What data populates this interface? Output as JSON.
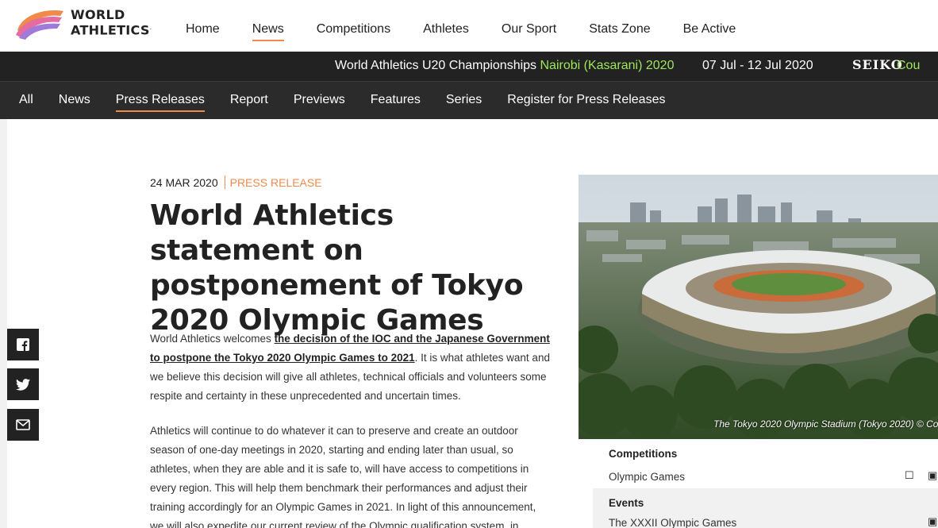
{
  "brand": {
    "line1": "WORLD",
    "line2": "ATHLETICS",
    "mark": "."
  },
  "main_nav": [
    {
      "label": "Home",
      "active": false
    },
    {
      "label": "News",
      "active": true
    },
    {
      "label": "Competitions",
      "active": false
    },
    {
      "label": "Athletes",
      "active": false
    },
    {
      "label": "Our Sport",
      "active": false
    },
    {
      "label": "Stats Zone",
      "active": false
    },
    {
      "label": "Be Active",
      "active": false
    }
  ],
  "ticker": {
    "event": "World Athletics U20 Championships",
    "location": "Nairobi (Kasarani) 2020",
    "dates": "07 Jul - 12 Jul 2020",
    "sponsor": "SEIKO",
    "sponsor_suffix": "Cou"
  },
  "sub_nav": [
    {
      "label": "All",
      "active": false
    },
    {
      "label": "News",
      "active": false
    },
    {
      "label": "Press Releases",
      "active": true
    },
    {
      "label": "Report",
      "active": false
    },
    {
      "label": "Previews",
      "active": false
    },
    {
      "label": "Features",
      "active": false
    },
    {
      "label": "Series",
      "active": false
    },
    {
      "label": "Register for Press Releases",
      "active": false
    }
  ],
  "share": [
    {
      "icon": "facebook-icon"
    },
    {
      "icon": "twitter-icon"
    },
    {
      "icon": "email-icon"
    }
  ],
  "article": {
    "date": "24 MAR 2020",
    "type": "PRESS RELEASE",
    "headline": "World Athletics statement on postponement of Tokyo 2020 Olympic Games",
    "p1_lead": "World Athletics welcomes ",
    "p1_link": "the decision of the IOC and the Japanese Government to postpone the Tokyo 2020 Olympic Games to 2021",
    "p1_rest": ". It is what athletes want and we believe this decision will give all athletes, technical officials and volunteers some respite and certainty in these unprecedented and uncertain times.",
    "p2": "Athletics will continue to do whatever it can to preserve and create an outdoor season of one-day meetings in 2020, starting and ending later than usual, so athletes, when they are able and it is safe to, will have access to competitions in every region. This will help them benchmark their performances and adjust their training accordingly for an Olympic Games in 2021. In light of this announcement, we will also expedite our current review of the Olympic qualification system, in"
  },
  "image": {
    "caption": "The Tokyo 2020 Olympic Stadium (Tokyo 2020) © Co"
  },
  "info": {
    "competitions_label": "Competitions",
    "competitions_value": "Olympic Games",
    "events_label": "Events",
    "events_value": "The XXXII Olympic Games"
  },
  "colors": {
    "accent": "#f08a4b",
    "ticker_bg": "#222222",
    "ticker_highlight": "#9de75b",
    "subnav_bg": "#2b2b2b"
  }
}
